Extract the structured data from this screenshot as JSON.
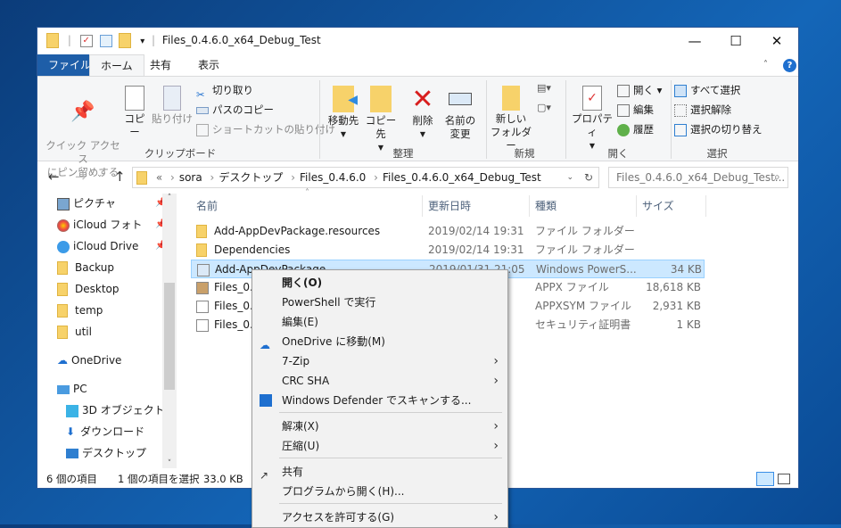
{
  "window": {
    "title": "Files_0.4.6.0_x64_Debug_Test",
    "minimize": "—",
    "maximize": "☐",
    "close": "✕"
  },
  "tabs": [
    "ファイル",
    "ホーム",
    "共有",
    "表示"
  ],
  "ribbon": {
    "clipboard": {
      "pin": "クイック アクセス\nにピン留めする",
      "copy": "コピー",
      "paste": "貼り付け",
      "cut": "切り取り",
      "copy_path": "パスのコピー",
      "paste_shortcut": "ショートカットの貼り付け",
      "group": "クリップボード"
    },
    "organize": {
      "move": "移動先",
      "copy_to": "コピー先",
      "delete": "削除",
      "rename": "名前の\n変更",
      "group": "整理"
    },
    "new": {
      "new_folder": "新しい\nフォルダー",
      "group": "新規"
    },
    "open": {
      "properties": "プロパティ",
      "open": "開く",
      "edit": "編集",
      "history": "履歴",
      "group": "開く"
    },
    "select": {
      "select_all": "すべて選択",
      "select_none": "選択解除",
      "invert": "選択の切り替え",
      "group": "選択"
    }
  },
  "address": {
    "crumbs": [
      "«",
      "sora",
      "デスクトップ",
      "Files_0.4.6.0",
      "Files_0.4.6.0_x64_Debug_Test"
    ],
    "search_placeholder": "Files_0.4.6.0_x64_Debug_Test..."
  },
  "nav": [
    "ピクチャ",
    "iCloud フォト",
    "iCloud Drive",
    "Backup",
    "Desktop",
    "temp",
    "util",
    "OneDrive",
    "PC",
    "3D オブジェクト",
    "ダウンロード",
    "デスクトップ"
  ],
  "columns": [
    "名前",
    "更新日時",
    "種類",
    "サイズ"
  ],
  "files": [
    {
      "name": "Add-AppDevPackage.resources",
      "date": "2019/02/14 19:31",
      "type": "ファイル フォルダー",
      "size": ""
    },
    {
      "name": "Dependencies",
      "date": "2019/02/14 19:31",
      "type": "ファイル フォルダー",
      "size": ""
    },
    {
      "name": "Add-AppDevPackage",
      "date": "2019/01/31 21:05",
      "type": "Windows PowerS...",
      "size": "34 KB"
    },
    {
      "name": "Files_0.4",
      "date": "",
      "type": "APPX ファイル",
      "size": "18,618 KB"
    },
    {
      "name": "Files_0.4",
      "date": "",
      "type": "APPXSYM ファイル",
      "size": "2,931 KB"
    },
    {
      "name": "Files_0.4",
      "date": "",
      "type": "セキュリティ証明書",
      "size": "1 KB"
    }
  ],
  "status": {
    "count": "6 個の項目",
    "selected": "1 個の項目を選択",
    "size": "33.0 KB"
  },
  "menu": [
    "開く(O)",
    "PowerShell で実行",
    "編集(E)",
    "OneDrive に移動(M)",
    "7-Zip",
    "CRC SHA",
    "Windows Defender でスキャンする...",
    "解凍(X)",
    "圧縮(U)",
    "共有",
    "プログラムから開く(H)...",
    "アクセスを許可する(G)"
  ],
  "colors": {
    "file_tab": "#1e5ea8",
    "selection": "#cce8ff",
    "menu_bg": "#f2f2f2"
  }
}
